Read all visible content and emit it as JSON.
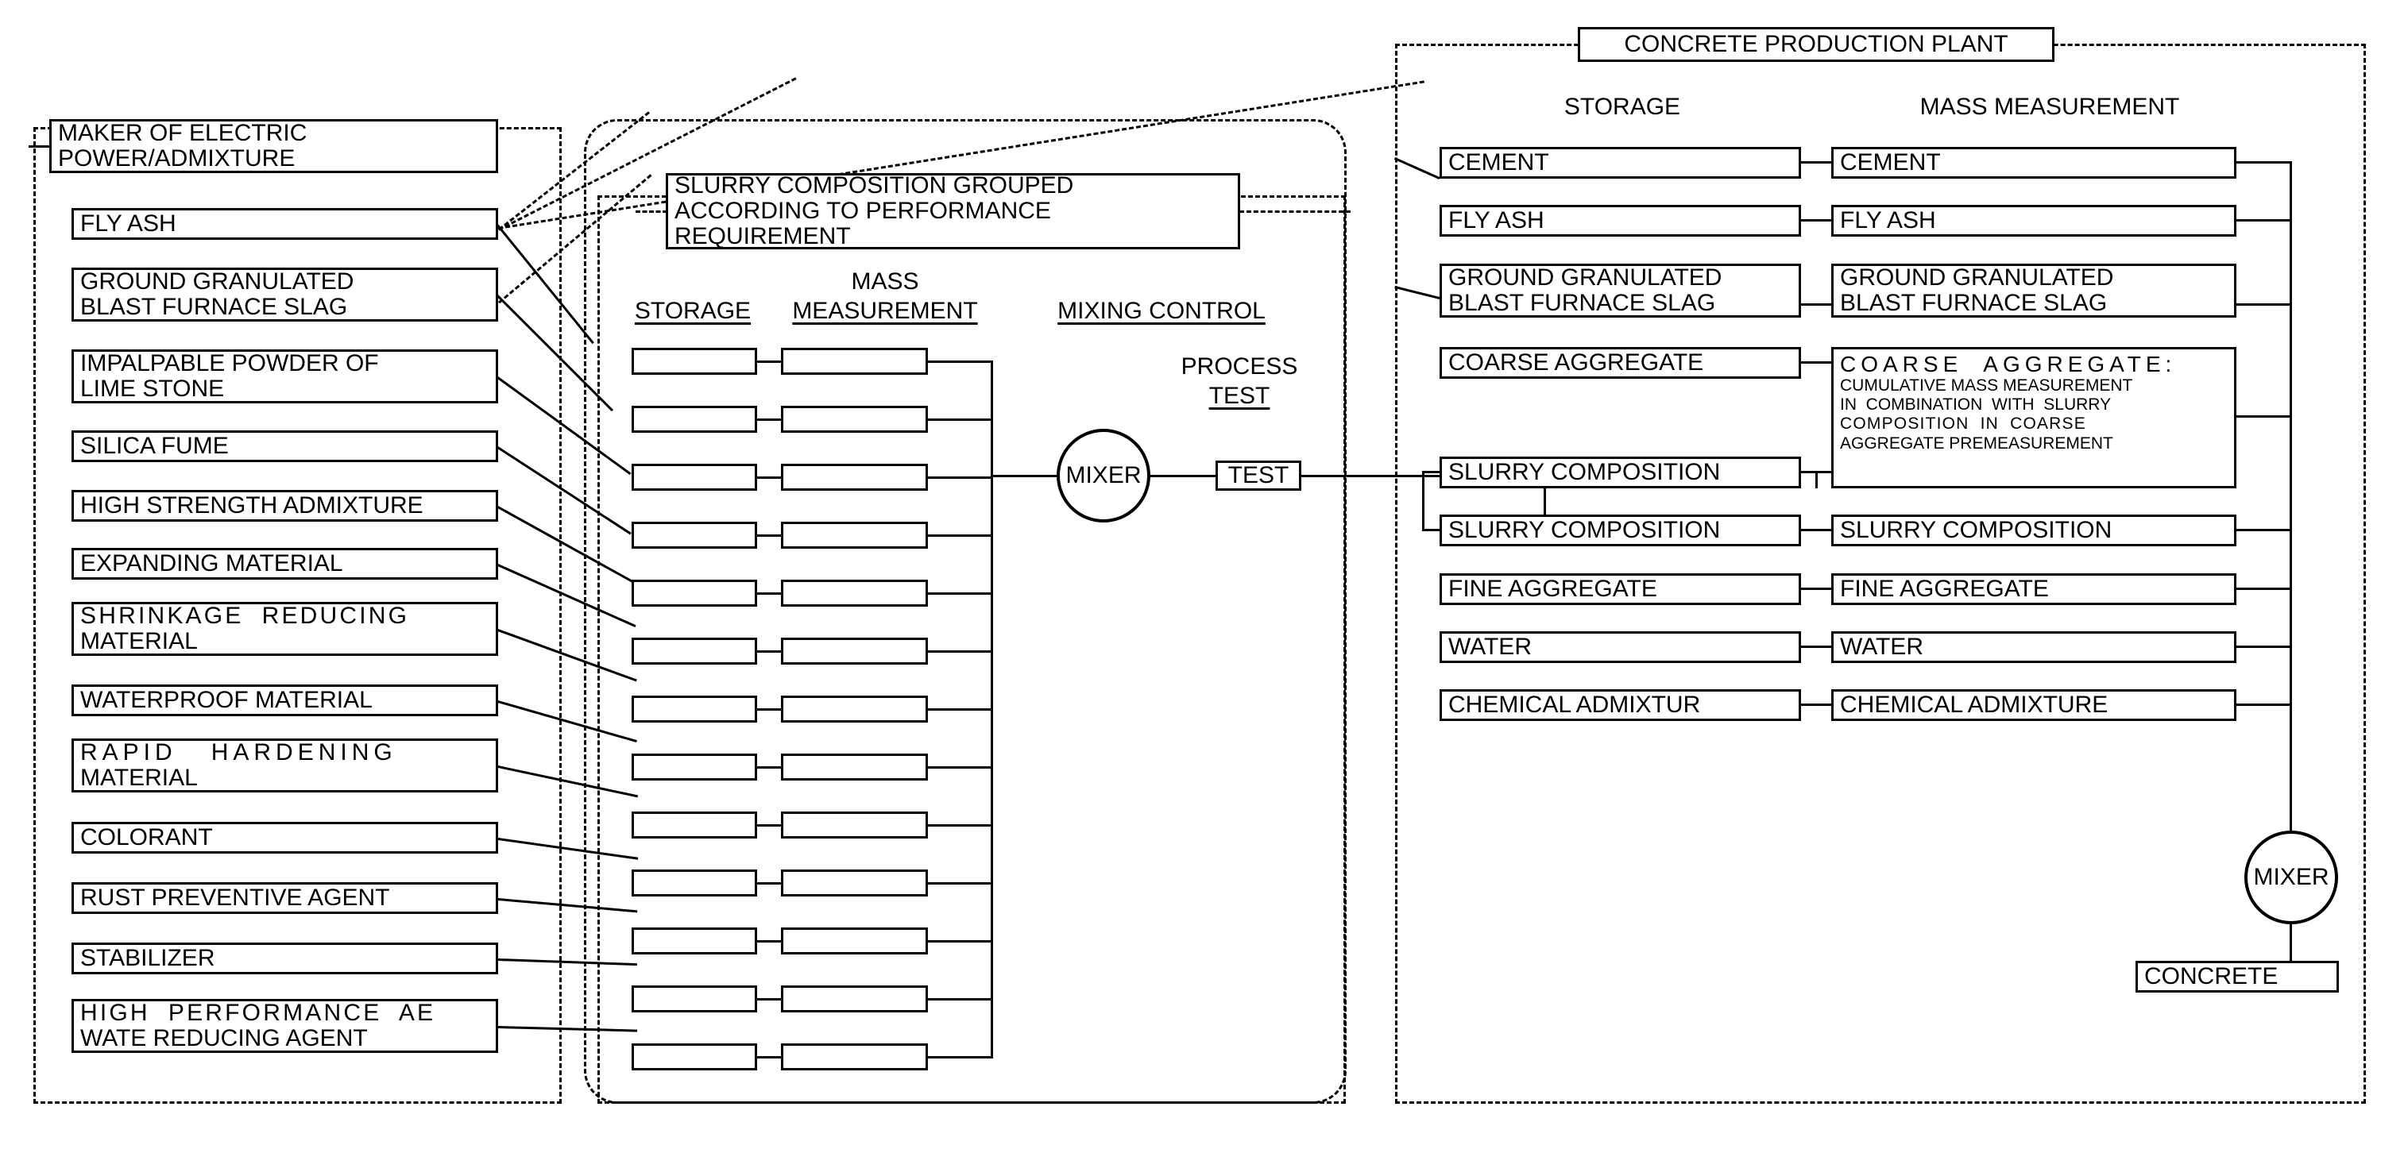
{
  "diagram": {
    "title": "CONCRETE PRODUCTION PLANT"
  },
  "left_panel": {
    "header": {
      "line1": "MAKER OF ELECTRIC",
      "line2": "POWER/ADMIXTURE"
    },
    "items": [
      {
        "line1": "FLY ASH",
        "line2": ""
      },
      {
        "line1": "GROUND GRANULATED",
        "line2": "BLAST FURNACE SLAG"
      },
      {
        "line1": "IMPALPABLE POWDER OF",
        "line2": "LIME STONE"
      },
      {
        "line1": "SILICA FUME",
        "line2": ""
      },
      {
        "line1": "HIGH STRENGTH ADMIXTURE",
        "line2": ""
      },
      {
        "line1": "EXPANDING MATERIAL",
        "line2": ""
      },
      {
        "line1": "SHRINKAGE  REDUCING",
        "line2": "MATERIAL"
      },
      {
        "line1": "WATERPROOF MATERIAL",
        "line2": ""
      },
      {
        "line1": "RAPID   HARDENING",
        "line2": "MATERIAL"
      },
      {
        "line1": "COLORANT",
        "line2": ""
      },
      {
        "line1": "RUST PREVENTIVE AGENT",
        "line2": ""
      },
      {
        "line1": "STABILIZER",
        "line2": ""
      },
      {
        "line1": "HIGH  PERFORMANCE  AE",
        "line2": "WATE REDUCING AGENT"
      }
    ]
  },
  "center_panel": {
    "slurry_note": {
      "line1": "SLURRY COMPOSITION GROUPED",
      "line2": "ACCORDING TO PERFORMANCE",
      "line3": "REQUIREMENT"
    },
    "column_headers": {
      "storage": "STORAGE",
      "mass_measurement_line1": "MASS",
      "mass_measurement_line2": "MEASUREMENT",
      "mixing_control": "MIXING CONTROL"
    },
    "process_test": {
      "line1": "PROCESS",
      "line2": "TEST"
    },
    "mixer_label": "MIXER",
    "test_label": "TEST",
    "ladder_row_count": 13
  },
  "right_panel": {
    "column_headers": {
      "storage": "STORAGE",
      "mass_measurement": "MASS MEASUREMENT"
    },
    "storage_items": [
      {
        "line1": "CEMENT",
        "line2": ""
      },
      {
        "line1": "FLY ASH",
        "line2": ""
      },
      {
        "line1": "GROUND GRANULATED",
        "line2": "BLAST FURNACE SLAG"
      },
      {
        "line1": "COARSE AGGREGATE",
        "line2": ""
      },
      {
        "line1": "SLURRY COMPOSITION",
        "line2": ""
      },
      {
        "line1": "SLURRY COMPOSITION",
        "line2": ""
      },
      {
        "line1": "FINE AGGREGATE",
        "line2": ""
      },
      {
        "line1": "WATER",
        "line2": ""
      },
      {
        "line1": "CHEMICAL ADMIXTUR",
        "line2": ""
      }
    ],
    "mass_items": [
      {
        "line1": "CEMENT",
        "line2": ""
      },
      {
        "line1": "FLY ASH",
        "line2": ""
      },
      {
        "line1": "GROUND GRANULATED",
        "line2": "BLAST FURNACE SLAG"
      },
      {
        "line1": "SLURRY COMPOSITION",
        "line2": ""
      },
      {
        "line1": "FINE AGGREGATE",
        "line2": ""
      },
      {
        "line1": "WATER",
        "line2": ""
      },
      {
        "line1": "CHEMICAL ADMIXTURE",
        "line2": ""
      }
    ],
    "coarse_aggregate_box": {
      "heading": "COARSE  AGGREGATE:",
      "line1": "CUMULATIVE MASS MEASUREMENT",
      "line2": "IN  COMBINATION  WITH  SLURRY",
      "line3": "COMPOSITION  IN  COARSE",
      "line4": "AGGREGATE PREMEASUREMENT"
    },
    "mixer_label": "MIXER",
    "concrete_label": "CONCRETE"
  },
  "colors": {
    "ink": "#000000",
    "paper": "#ffffff"
  }
}
